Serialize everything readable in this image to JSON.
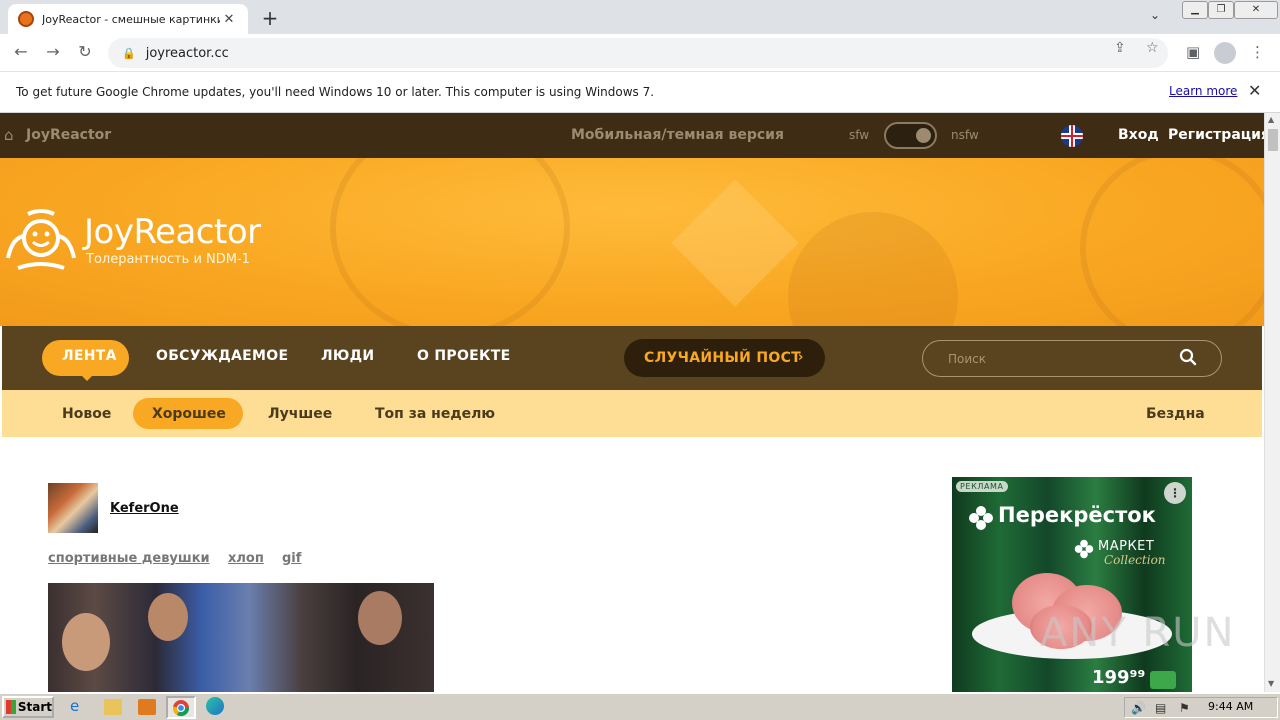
{
  "browser": {
    "tab_title": "JoyReactor - смешные картинки и",
    "tab_close": "✕",
    "new_tab": "+",
    "url": "joyreactor.cc",
    "infobar_text": "To get future Google Chrome updates, you'll need Windows 10 or later. This computer is using Windows 7.",
    "learn_more": "Learn more"
  },
  "topbar": {
    "brand": "JoyReactor",
    "mobile_link": "Мобильная/темная версия",
    "sfw": "sfw",
    "nsfw": "nsfw",
    "login": "Вход",
    "register": "Регистрация"
  },
  "banner": {
    "title": "JoyReactor",
    "subtitle": "Толерантность и NDM-1"
  },
  "mainnav": {
    "items": [
      {
        "label": "ЛЕНТА",
        "active": true
      },
      {
        "label": "ОБСУЖДАЕМОЕ"
      },
      {
        "label": "ЛЮДИ"
      },
      {
        "label": "О ПРОЕКТЕ"
      }
    ],
    "random_post": "СЛУЧАЙНЫЙ ПОСТ",
    "random_arrow": "›",
    "search_placeholder": "Поиск"
  },
  "subnav": {
    "items": [
      {
        "label": "Новое"
      },
      {
        "label": "Хорошее",
        "active": true
      },
      {
        "label": "Лучшее"
      },
      {
        "label": "Топ за неделю"
      }
    ],
    "abyss": "Бездна"
  },
  "post": {
    "author": "KeferOne",
    "tags": [
      "спортивные девушки",
      "хлоп",
      "gif"
    ]
  },
  "ad": {
    "label": "РЕКЛАМА",
    "brand": "Перекрёсток",
    "market": "МАРКЕТ",
    "collection": "Collection",
    "price": "199⁹⁹"
  },
  "watermark": "ANY RUN",
  "taskbar": {
    "start": "Start",
    "clock": "9:44 AM"
  },
  "colors": {
    "topbar": "#3e2d14",
    "accent": "#f9a823",
    "mainnav": "#59441f",
    "subnav": "#fedd95"
  }
}
